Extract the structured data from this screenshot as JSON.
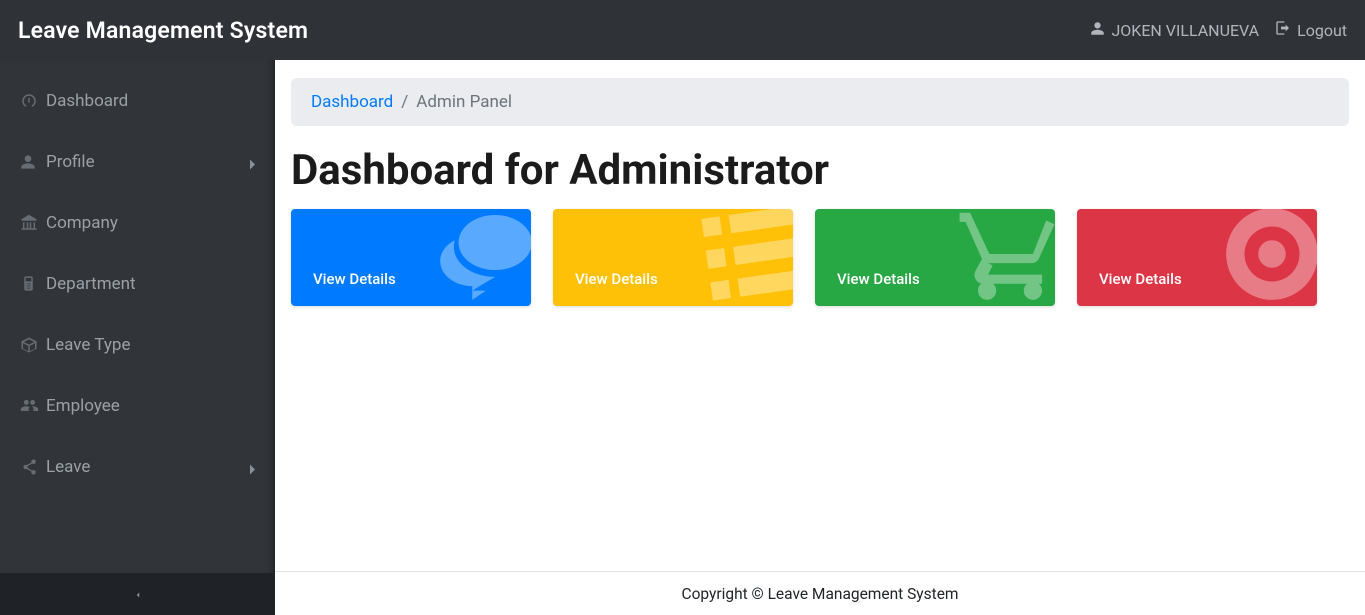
{
  "app": {
    "brand": "Leave Management System",
    "user_name": "JOKEN VILLANUEVA",
    "logout_label": "Logout"
  },
  "sidebar": {
    "items": [
      {
        "label": "Dashboard",
        "icon": "dashboard-icon",
        "children": false
      },
      {
        "label": "Profile",
        "icon": "user-icon",
        "children": true
      },
      {
        "label": "Company",
        "icon": "bank-icon",
        "children": false
      },
      {
        "label": "Department",
        "icon": "clipboard-icon",
        "children": false
      },
      {
        "label": "Leave Type",
        "icon": "box-icon",
        "children": false
      },
      {
        "label": "Employee",
        "icon": "users-icon",
        "children": false
      },
      {
        "label": "Leave",
        "icon": "share-icon",
        "children": true
      }
    ]
  },
  "breadcrumb": {
    "link": "Dashboard",
    "sep": "/",
    "current": "Admin Panel"
  },
  "page": {
    "title": "Dashboard for Administrator"
  },
  "cards": [
    {
      "color": "blue",
      "label": "View Details",
      "icon": "comments-icon"
    },
    {
      "color": "yellow",
      "label": "View Details",
      "icon": "tasks-icon"
    },
    {
      "color": "green",
      "label": "View Details",
      "icon": "cart-icon"
    },
    {
      "color": "red",
      "label": "View Details",
      "icon": "support-icon"
    }
  ],
  "footer": "Copyright © Leave Management System"
}
